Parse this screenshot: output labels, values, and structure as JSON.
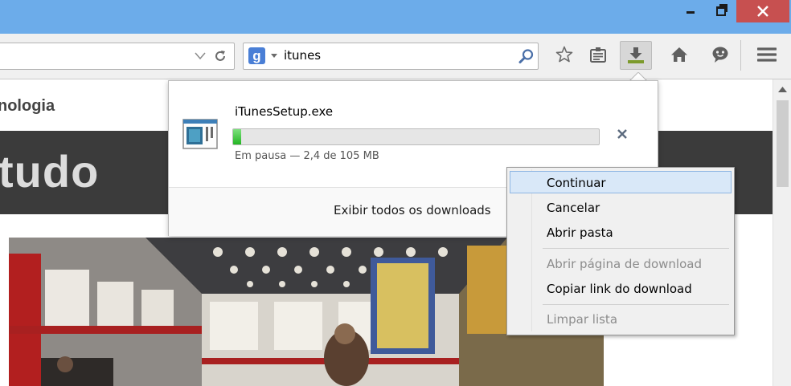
{
  "search": {
    "engine_letter": "g",
    "query": "itunes"
  },
  "page": {
    "site_title": "nologia",
    "band_text": "tudo"
  },
  "download": {
    "filename": "iTunesSetup.exe",
    "progress_fraction": 0.023,
    "status": "Em pausa —  2,4 de 105 MB",
    "show_all": "Exibir todos os downloads"
  },
  "context_menu": {
    "items": [
      {
        "label": "Continuar",
        "selected": true,
        "disabled": false
      },
      {
        "label": "Cancelar",
        "selected": false,
        "disabled": false
      },
      {
        "label": "Abrir pasta",
        "selected": false,
        "disabled": false
      },
      {
        "label": "Abrir página de download",
        "selected": false,
        "disabled": true
      },
      {
        "label": "Copiar link do download",
        "selected": false,
        "disabled": false
      },
      {
        "label": "Limpar lista",
        "selected": false,
        "disabled": true
      }
    ]
  },
  "toolbar": {
    "icons": [
      "star-icon",
      "reading-list-icon",
      "download-icon",
      "home-icon",
      "chat-icon",
      "menu-icon"
    ]
  },
  "colors": {
    "titlebar": "#6cacea",
    "close_button": "#c75050",
    "progress": "#23b523",
    "menu_highlight": "#d9e8f8",
    "band": "#3b3b3b"
  }
}
